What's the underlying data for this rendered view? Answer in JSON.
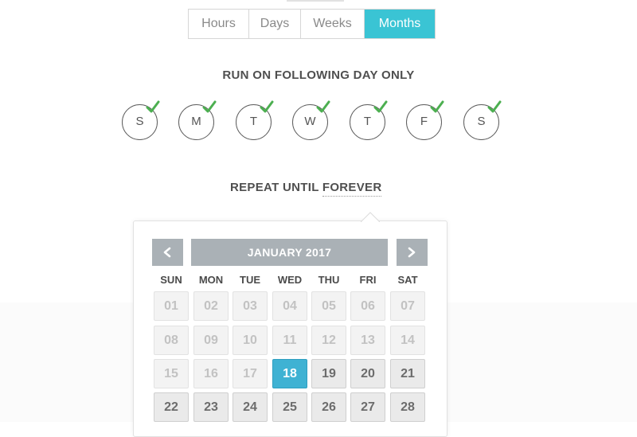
{
  "period_tabs": [
    {
      "label": "Hours",
      "active": false
    },
    {
      "label": "Days",
      "active": false
    },
    {
      "label": "Weeks",
      "active": false
    },
    {
      "label": "Months",
      "active": true
    }
  ],
  "run_heading": "RUN ON FOLLOWING DAY ONLY",
  "days": [
    "S",
    "M",
    "T",
    "W",
    "T",
    "F",
    "S"
  ],
  "repeat": {
    "prefix": "REPEAT UNTIL",
    "value": "FOREVER"
  },
  "calendar": {
    "title": "JANUARY 2017",
    "prev_icon": "chevron-left-icon",
    "next_icon": "chevron-right-icon",
    "weekdays": [
      "SUN",
      "MON",
      "TUE",
      "WED",
      "THU",
      "FRI",
      "SAT"
    ],
    "rows": [
      [
        "01",
        "02",
        "03",
        "04",
        "05",
        "06",
        "07"
      ],
      [
        "08",
        "09",
        "10",
        "11",
        "12",
        "13",
        "14"
      ],
      [
        "15",
        "16",
        "17",
        "18",
        "19",
        "20",
        "21"
      ],
      [
        "22",
        "23",
        "24",
        "25",
        "26",
        "27",
        "28"
      ]
    ],
    "selected": "18"
  },
  "colors": {
    "accent": "#3ac4d4",
    "selected": "#3fb2d3",
    "check": "#4caf50",
    "header_bar": "#aab1b6"
  }
}
